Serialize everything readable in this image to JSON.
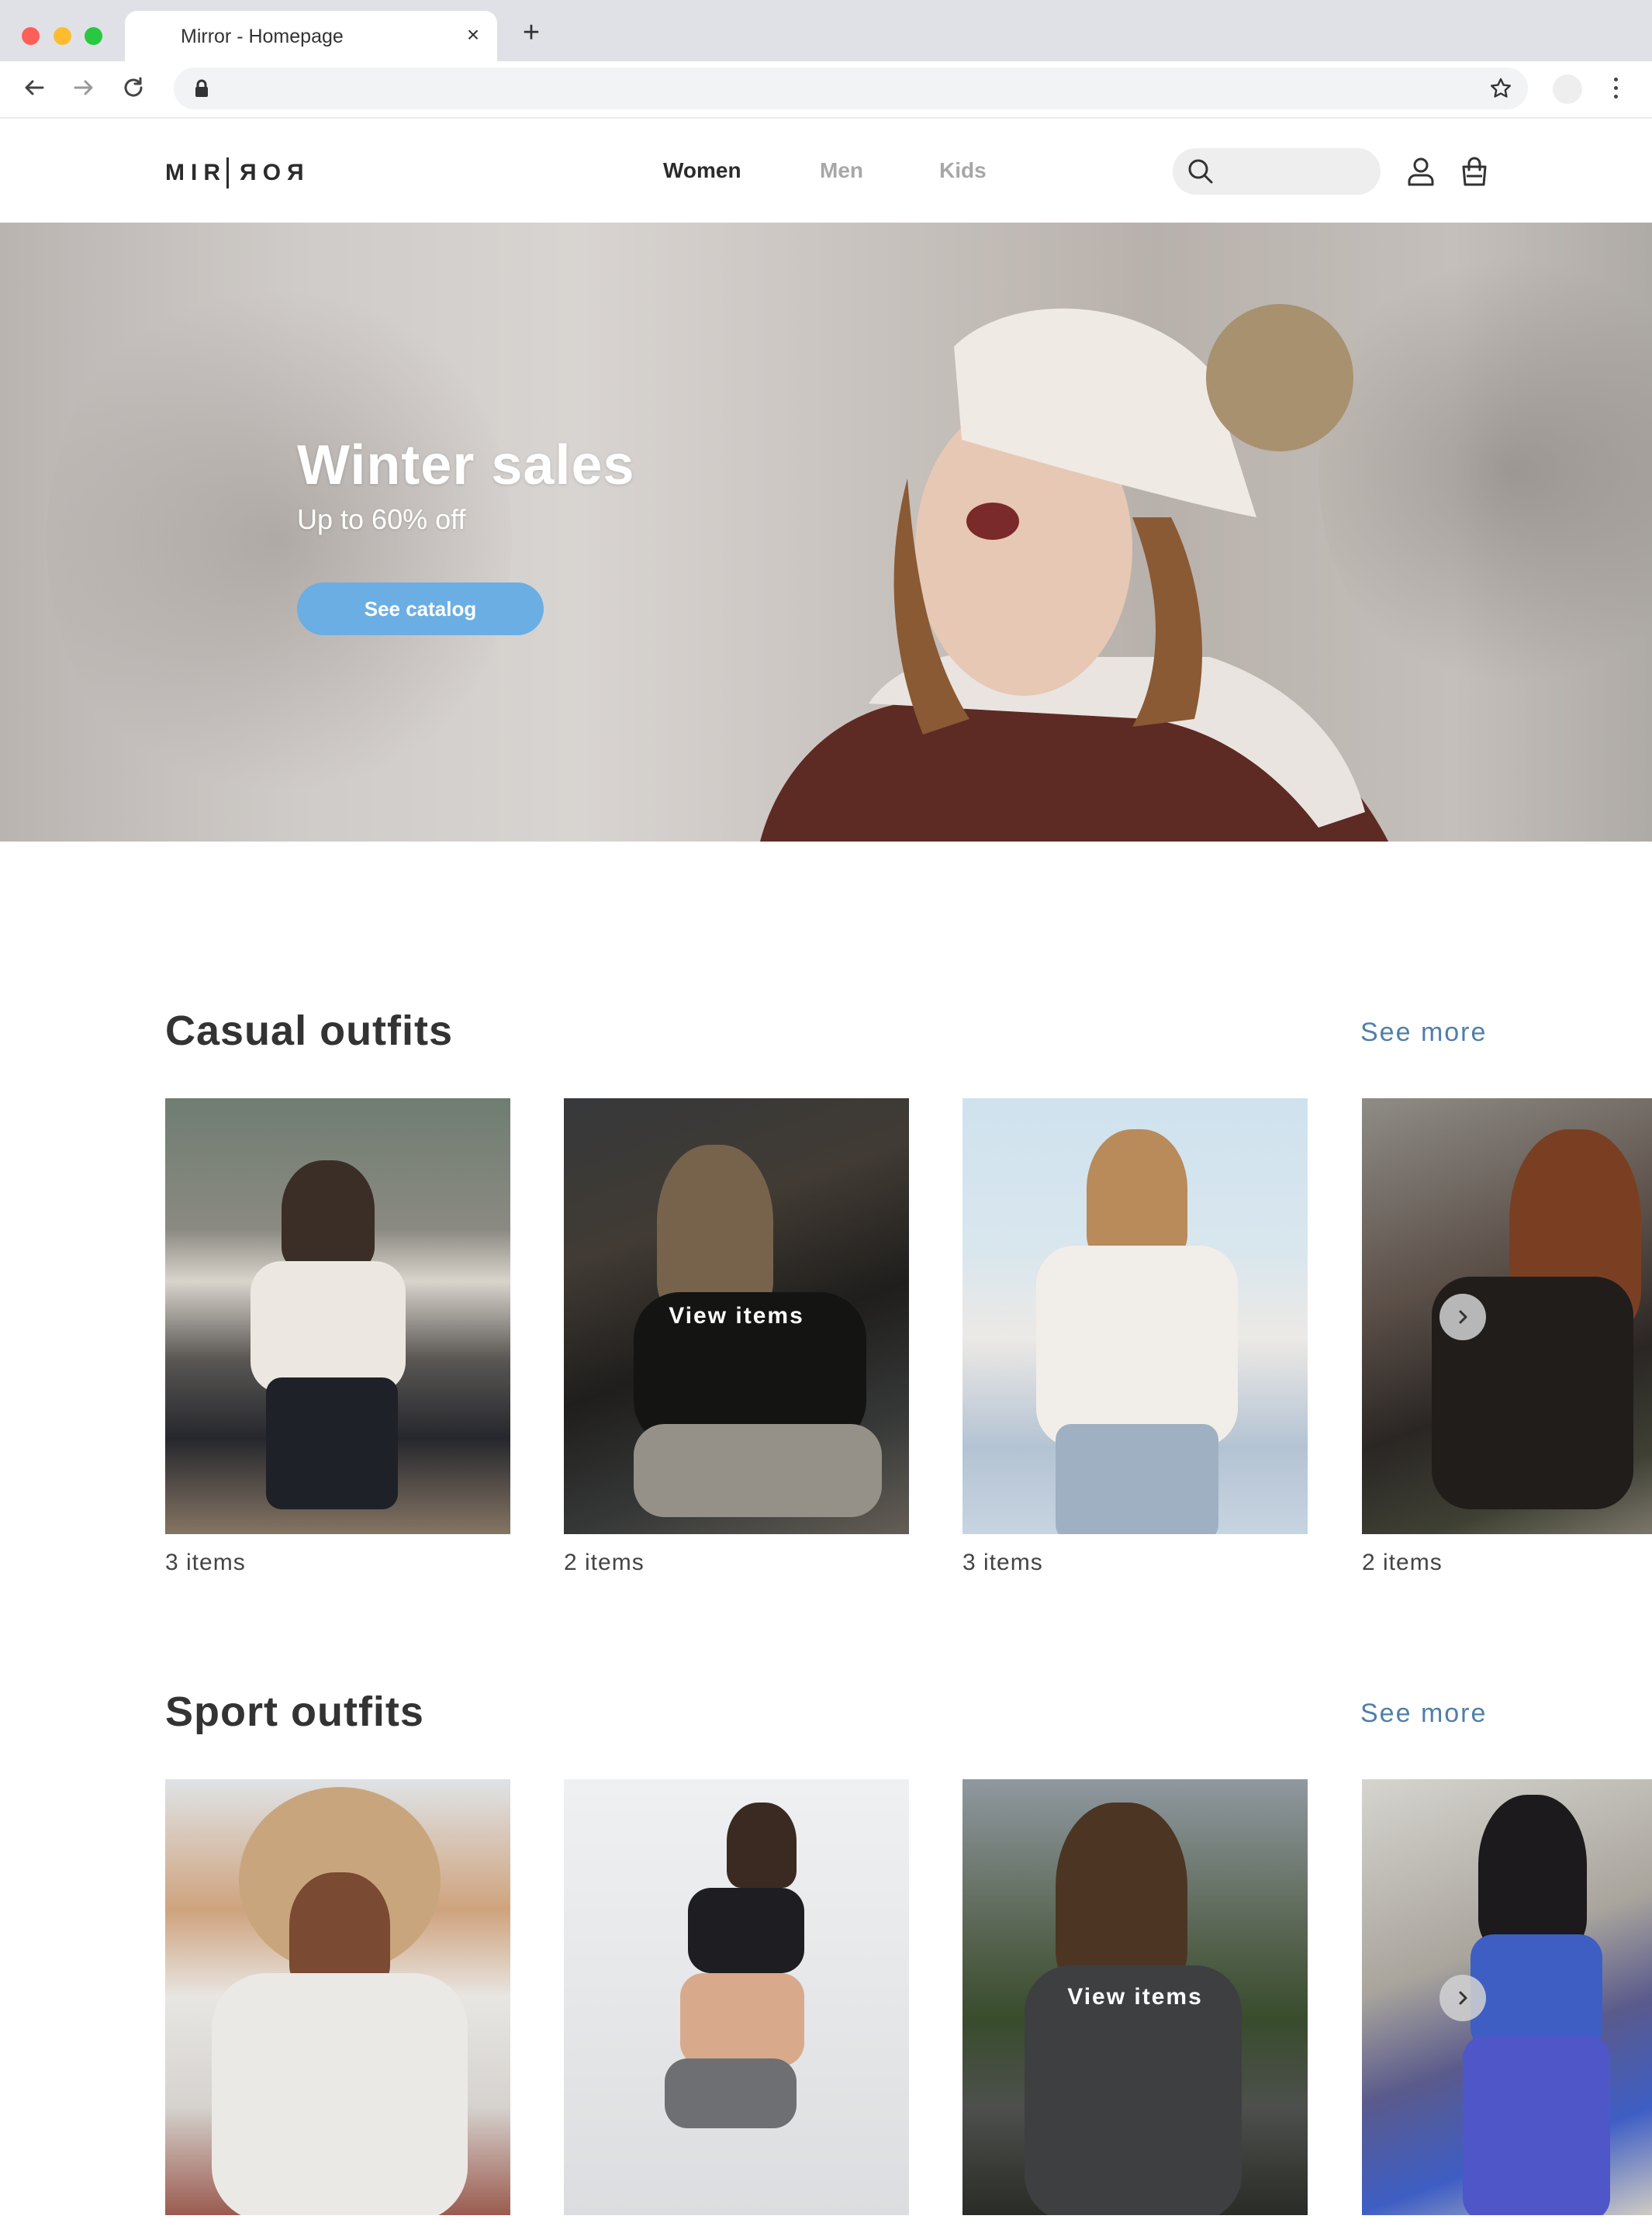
{
  "browser": {
    "tab_title": "Mirror - Homepage",
    "tab_close": "×",
    "new_tab": "+",
    "url": ""
  },
  "site": {
    "logo_left": "MIR",
    "logo_right": "ROR",
    "nav": [
      "Women",
      "Men",
      "Kids"
    ],
    "active_nav": "Women",
    "search_placeholder": ""
  },
  "hero": {
    "title": "Winter sales",
    "subtitle": "Up to 60% off",
    "cta": "See catalog"
  },
  "sections": [
    {
      "title": "Casual outfits",
      "see_more": "See more",
      "cards": [
        {
          "count": "3 items"
        },
        {
          "count": "2 items",
          "overlay": "View items"
        },
        {
          "count": "3 items"
        },
        {
          "count": "2 items"
        }
      ]
    },
    {
      "title": "Sport outfits",
      "see_more": "See more",
      "cards": [
        {
          "count": ""
        },
        {
          "count": ""
        },
        {
          "count": "",
          "overlay": "View items"
        },
        {
          "count": ""
        }
      ]
    }
  ],
  "colors": {
    "accent": "#6aaee4",
    "link": "#4f7fa8",
    "text": "#2b2b2b",
    "nav_inactive": "#a7a7a7"
  },
  "icons": [
    "back-icon",
    "forward-icon",
    "reload-icon",
    "lock-icon",
    "star-icon",
    "search-icon",
    "user-icon",
    "bag-icon",
    "chevron-right-icon"
  ]
}
